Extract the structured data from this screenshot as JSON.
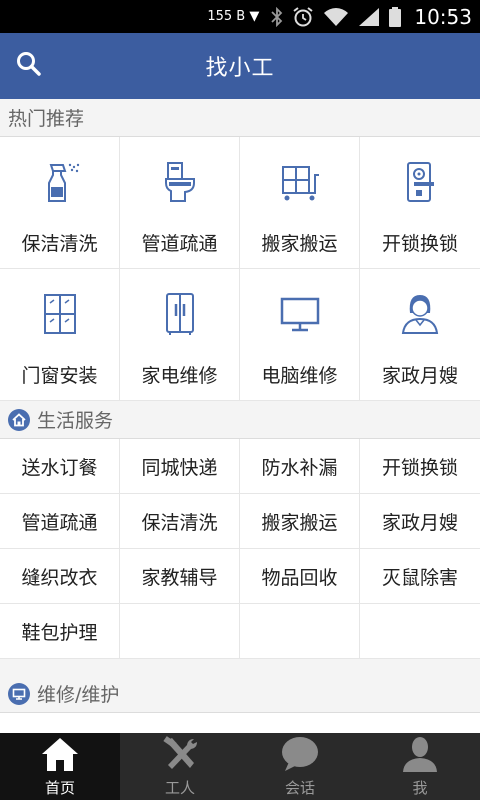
{
  "status_bar": {
    "network": "155 B ▼",
    "time": "10:53"
  },
  "header": {
    "title": "找小工"
  },
  "hot": {
    "title": "热门推荐",
    "items": [
      {
        "label": "保洁清洗",
        "icon": "spray-bottle-icon"
      },
      {
        "label": "管道疏通",
        "icon": "toilet-icon"
      },
      {
        "label": "搬家搬运",
        "icon": "cart-icon"
      },
      {
        "label": "开锁换锁",
        "icon": "door-lock-icon"
      },
      {
        "label": "门窗安装",
        "icon": "window-icon"
      },
      {
        "label": "家电维修",
        "icon": "fridge-icon"
      },
      {
        "label": "电脑维修",
        "icon": "monitor-icon"
      },
      {
        "label": "家政月嫂",
        "icon": "person-icon"
      }
    ]
  },
  "life": {
    "title": "生活服务",
    "items": [
      "送水订餐",
      "同城快递",
      "防水补漏",
      "开锁换锁",
      "管道疏通",
      "保洁清洗",
      "搬家搬运",
      "家政月嫂",
      "缝织改衣",
      "家教辅导",
      "物品回收",
      "灭鼠除害",
      "鞋包护理",
      "",
      "",
      ""
    ]
  },
  "repair": {
    "title": "维修/维护"
  },
  "nav": [
    {
      "label": "首页",
      "icon": "home-icon",
      "active": true
    },
    {
      "label": "工人",
      "icon": "tools-icon",
      "active": false
    },
    {
      "label": "会话",
      "icon": "chat-bubble-icon",
      "active": false
    },
    {
      "label": "我",
      "icon": "user-icon",
      "active": false
    }
  ],
  "colors": {
    "header": "#3c5da0",
    "icon_blue": "#4a6eb0",
    "nav_bg": "#2a2a2a"
  }
}
